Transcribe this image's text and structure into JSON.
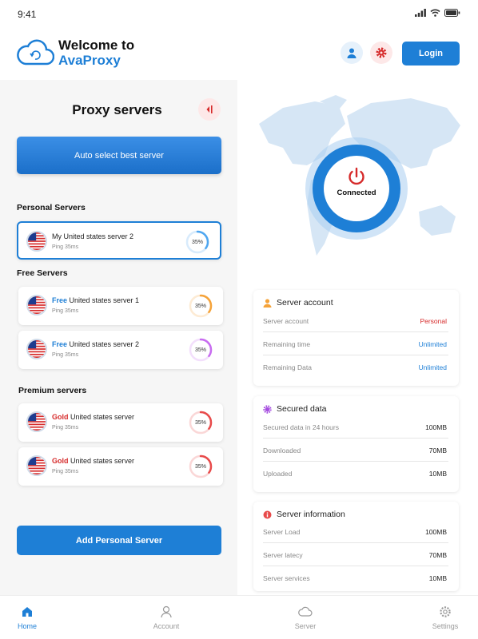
{
  "status_bar": {
    "time": "9:41"
  },
  "header": {
    "brand_line1": "Welcome to",
    "brand_line2": "AvaProxy",
    "login_label": "Login"
  },
  "proxy_panel": {
    "title": "Proxy servers",
    "auto_select_label": "Auto select best server",
    "add_server_label": "Add Personal Server",
    "sections": {
      "personal": "Personal Servers",
      "free": "Free Servers",
      "premium": "Premium servers"
    },
    "servers": [
      {
        "tier": "",
        "name": "My United states server 2",
        "ping": "Ping 35ms",
        "load": "35%",
        "ring_color": "#4ea6f0",
        "selected": true
      },
      {
        "tier": "Free",
        "name": " United states server 1",
        "ping": "Ping 35ms",
        "load": "35%",
        "ring_color": "#f5a33a",
        "selected": false
      },
      {
        "tier": "Free",
        "name": " United states server 2",
        "ping": "Ping 35ms",
        "load": "35%",
        "ring_color": "#c86cf0",
        "selected": false
      },
      {
        "tier": "Gold",
        "name": " United states server",
        "ping": "Ping 35ms",
        "load": "35%",
        "ring_color": "#e84b4b",
        "selected": false
      },
      {
        "tier": "Gold",
        "name": " United states server",
        "ping": "Ping 35ms",
        "load": "35%",
        "ring_color": "#e84b4b",
        "selected": false
      }
    ]
  },
  "connection": {
    "status": "Connected"
  },
  "server_account": {
    "title": "Server account",
    "rows": [
      {
        "label": "Server account",
        "value": "Personal"
      },
      {
        "label": "Remaining time",
        "value": "Unlimited"
      },
      {
        "label": "Remaining Data",
        "value": "Unlimited"
      }
    ]
  },
  "secured_data": {
    "title": "Secured data",
    "rows": [
      {
        "label": "Secured data in 24 hours",
        "value": "100MB"
      },
      {
        "label": "Downloaded",
        "value": "70MB"
      },
      {
        "label": "Uploaded",
        "value": "10MB"
      }
    ]
  },
  "server_information": {
    "title": "Server information",
    "rows": [
      {
        "label": "Server Load",
        "value": "100MB"
      },
      {
        "label": "Server latecy",
        "value": "70MB"
      },
      {
        "label": "Server services",
        "value": "10MB"
      }
    ]
  },
  "bottom_nav": [
    {
      "label": "Home",
      "icon": "home-icon"
    },
    {
      "label": "Account",
      "icon": "user-icon"
    },
    {
      "label": "Server",
      "icon": "cloud-icon"
    },
    {
      "label": "Settings",
      "icon": "settings-icon"
    }
  ],
  "colors": {
    "primary": "#1e7fd6",
    "danger": "#d62b2b",
    "panel_bg": "#f6f6f6",
    "map": "#d6e6f5"
  }
}
